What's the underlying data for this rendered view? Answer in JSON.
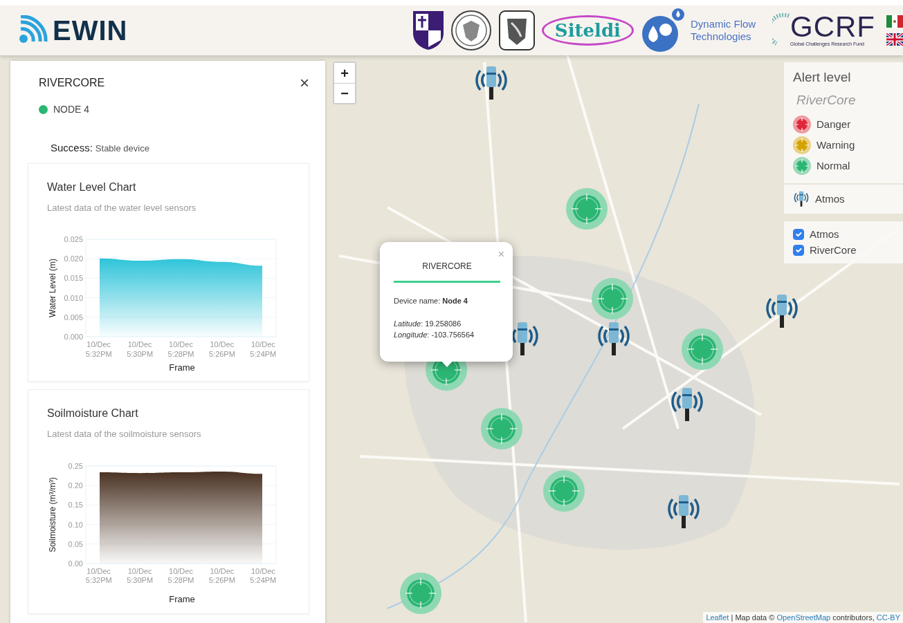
{
  "header": {
    "brand": "EWIN",
    "partners": [
      {
        "kind": "shield"
      },
      {
        "kind": "seal"
      },
      {
        "kind": "crest"
      },
      {
        "kind": "oval",
        "text": "Siteldi"
      },
      {
        "kind": "drops"
      },
      {
        "kind": "wordmark",
        "text": "Dynamic Flow Technologies"
      },
      {
        "kind": "gcrf",
        "text": "GCRF",
        "subtext": "Global Challenges Research Fund"
      }
    ],
    "languages": [
      {
        "kind": "mx"
      },
      {
        "kind": "uk"
      }
    ]
  },
  "panel": {
    "title": "RIVERCORE",
    "close": "×",
    "node": {
      "label": "NODE 4",
      "color": "#2bb673"
    },
    "status_label": "Success:",
    "status_text": "Stable device",
    "cards": [
      {
        "title": "Water Level Chart",
        "subtitle": "Latest data of the water level sensors",
        "chart_data": {
          "type": "area",
          "xlabel": "Frame",
          "ylabel": "Water Level (m)",
          "categories": [
            "10/Dec 5:32PM",
            "10/Dec 5:30PM",
            "10/Dec 5:28PM",
            "10/Dec 5:26PM",
            "10/Dec 5:24PM"
          ],
          "ylim": [
            0,
            0.025
          ],
          "yticks": [
            {
              "value": 0,
              "label": "0.000"
            },
            {
              "value": 0.005,
              "label": "0.005"
            },
            {
              "value": 0.01,
              "label": "0.010"
            },
            {
              "value": 0.015,
              "label": "0.015"
            },
            {
              "value": 0.02,
              "label": "0.020"
            },
            {
              "value": 0.025,
              "label": "0.025"
            }
          ],
          "grid": true,
          "series": [
            {
              "color": "#2ec4d9",
              "values": [
                0.0201,
                0.0195,
                0.0199,
                0.0192,
                0.0182
              ]
            }
          ]
        }
      },
      {
        "title": "Soilmoisture Chart",
        "subtitle": "Latest data of the soilmoisture sensors",
        "chart_data": {
          "type": "area",
          "xlabel": "Frame",
          "ylabel": "Soilmoisture (m³/m³)",
          "categories": [
            "10/Dec 5:32PM",
            "10/Dec 5:30PM",
            "10/Dec 5:28PM",
            "10/Dec 5:26PM",
            "10/Dec 5:24PM"
          ],
          "ylim": [
            0,
            0.25
          ],
          "yticks": [
            {
              "value": 0,
              "label": "0.00"
            },
            {
              "value": 0.05,
              "label": "0.05"
            },
            {
              "value": 0.1,
              "label": "0.10"
            },
            {
              "value": 0.15,
              "label": "0.15"
            },
            {
              "value": 0.2,
              "label": "0.20"
            },
            {
              "value": 0.25,
              "label": "0.25"
            }
          ],
          "grid": true,
          "series": [
            {
              "color": "#4a3222",
              "values": [
                0.234,
                0.232,
                0.234,
                0.236,
                0.23
              ]
            }
          ]
        }
      }
    ]
  },
  "map": {
    "zoom_in": "+",
    "zoom_out": "−",
    "markers": [
      {
        "kind": "rivercore"
      },
      {
        "kind": "rivercore"
      },
      {
        "kind": "rivercore"
      },
      {
        "kind": "rivercore"
      },
      {
        "kind": "rivercore"
      },
      {
        "kind": "rivercore"
      },
      {
        "kind": "rivercore"
      },
      {
        "kind": "atmos"
      },
      {
        "kind": "atmos"
      },
      {
        "kind": "atmos"
      },
      {
        "kind": "atmos"
      },
      {
        "kind": "atmos"
      },
      {
        "kind": "atmos"
      }
    ],
    "popup": {
      "close": "×",
      "title": "RIVERCORE",
      "device": "Device name: **Node 4**",
      "latitude": "*Latitude*: 19.258086",
      "longitude": "*Longitude*: -103.756564"
    },
    "legend": {
      "title": "Alert level",
      "subtitle": "RiverCore",
      "levels": [
        {
          "label": "Danger",
          "color": "#e0283a"
        },
        {
          "label": "Warning",
          "color": "#d4a300"
        },
        {
          "label": "Normal",
          "color": "#2bb673"
        }
      ],
      "device_label": "Atmos",
      "layers": [
        {
          "label": "Atmos",
          "checked": true
        },
        {
          "label": "RiverCore",
          "checked": true
        }
      ]
    },
    "attribution": [
      {
        "kind": "link",
        "text": "Leaflet"
      },
      {
        "kind": "text",
        "text": " | Map data © "
      },
      {
        "kind": "link",
        "text": "OpenStreetMap"
      },
      {
        "kind": "text",
        "text": " contributors, "
      },
      {
        "kind": "link",
        "text": "CC-BY"
      }
    ]
  }
}
